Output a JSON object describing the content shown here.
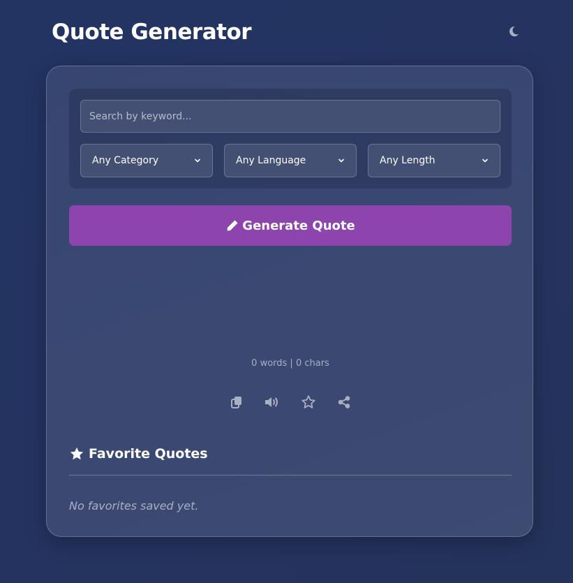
{
  "header": {
    "title": "Quote Generator",
    "theme_icon": "moon-icon"
  },
  "filters": {
    "search": {
      "placeholder": "Search by keyword...",
      "value": ""
    },
    "category": {
      "selected": "Any Category"
    },
    "language": {
      "selected": "Any Language"
    },
    "length": {
      "selected": "Any Length"
    }
  },
  "generate": {
    "label": "Generate Quote",
    "icon": "pencil-icon",
    "color": "#8e44ad"
  },
  "stats": {
    "text": "0 words | 0 chars"
  },
  "actions": [
    {
      "icon": "copy-icon"
    },
    {
      "icon": "speaker-icon"
    },
    {
      "icon": "star-outline-icon"
    },
    {
      "icon": "share-icon"
    }
  ],
  "favorites": {
    "heading": "Favorite Quotes",
    "icon": "star-icon",
    "empty_text": "No favorites saved yet."
  },
  "colors": {
    "background": "#233463",
    "card": "#3a4872",
    "accent": "#8e44ad",
    "muted_text": "#a9b0c4"
  }
}
